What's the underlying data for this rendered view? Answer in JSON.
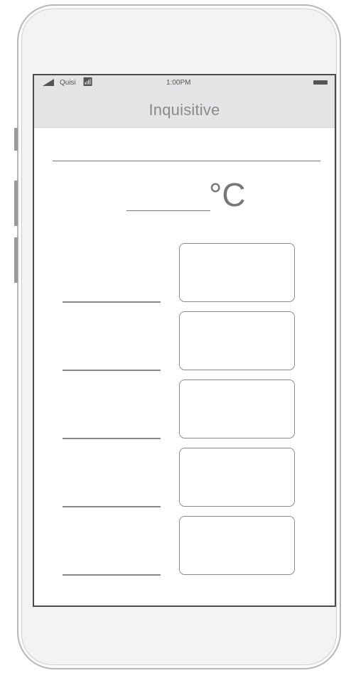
{
  "status_bar": {
    "carrier": "Quisi",
    "time": "1:00PM",
    "signal_icon": "signal-icon",
    "wifi_icon": "wifi-icon",
    "battery_icon": "battery-icon"
  },
  "nav": {
    "title": "Inquisitive"
  },
  "temperature": {
    "value": "",
    "unit": "°C"
  },
  "rows": [
    {
      "label": "",
      "value": ""
    },
    {
      "label": "",
      "value": ""
    },
    {
      "label": "",
      "value": ""
    },
    {
      "label": "",
      "value": ""
    },
    {
      "label": "",
      "value": ""
    }
  ]
}
